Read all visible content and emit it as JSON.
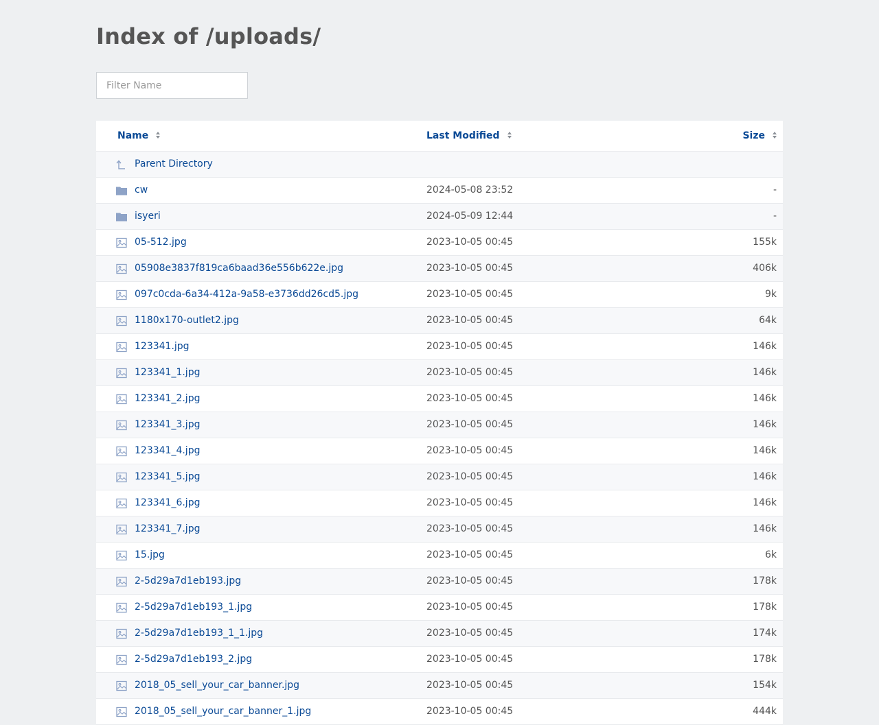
{
  "title": "Index of /uploads/",
  "filter": {
    "placeholder": "Filter Name",
    "value": ""
  },
  "columns": {
    "name": "Name",
    "modified": "Last Modified",
    "size": "Size"
  },
  "colors": {
    "link": "#0b4a96",
    "folder": "#8ea3c7",
    "background": "#eef0f2"
  },
  "parent": {
    "label": "Parent Directory",
    "icon": "arrow-up-icon"
  },
  "rows": [
    {
      "name": "cw",
      "modified": "2024-05-08 23:52",
      "size": "-",
      "type": "folder"
    },
    {
      "name": "isyeri",
      "modified": "2024-05-09 12:44",
      "size": "-",
      "type": "folder"
    },
    {
      "name": "05-512.jpg",
      "modified": "2023-10-05 00:45",
      "size": "155k",
      "type": "image"
    },
    {
      "name": "05908e3837f819ca6baad36e556b622e.jpg",
      "modified": "2023-10-05 00:45",
      "size": "406k",
      "type": "image"
    },
    {
      "name": "097c0cda-6a34-412a-9a58-e3736dd26cd5.jpg",
      "modified": "2023-10-05 00:45",
      "size": "9k",
      "type": "image"
    },
    {
      "name": "1180x170-outlet2.jpg",
      "modified": "2023-10-05 00:45",
      "size": "64k",
      "type": "image"
    },
    {
      "name": "123341.jpg",
      "modified": "2023-10-05 00:45",
      "size": "146k",
      "type": "image"
    },
    {
      "name": "123341_1.jpg",
      "modified": "2023-10-05 00:45",
      "size": "146k",
      "type": "image"
    },
    {
      "name": "123341_2.jpg",
      "modified": "2023-10-05 00:45",
      "size": "146k",
      "type": "image"
    },
    {
      "name": "123341_3.jpg",
      "modified": "2023-10-05 00:45",
      "size": "146k",
      "type": "image"
    },
    {
      "name": "123341_4.jpg",
      "modified": "2023-10-05 00:45",
      "size": "146k",
      "type": "image"
    },
    {
      "name": "123341_5.jpg",
      "modified": "2023-10-05 00:45",
      "size": "146k",
      "type": "image"
    },
    {
      "name": "123341_6.jpg",
      "modified": "2023-10-05 00:45",
      "size": "146k",
      "type": "image"
    },
    {
      "name": "123341_7.jpg",
      "modified": "2023-10-05 00:45",
      "size": "146k",
      "type": "image"
    },
    {
      "name": "15.jpg",
      "modified": "2023-10-05 00:45",
      "size": "6k",
      "type": "image"
    },
    {
      "name": "2-5d29a7d1eb193.jpg",
      "modified": "2023-10-05 00:45",
      "size": "178k",
      "type": "image"
    },
    {
      "name": "2-5d29a7d1eb193_1.jpg",
      "modified": "2023-10-05 00:45",
      "size": "178k",
      "type": "image"
    },
    {
      "name": "2-5d29a7d1eb193_1_1.jpg",
      "modified": "2023-10-05 00:45",
      "size": "174k",
      "type": "image"
    },
    {
      "name": "2-5d29a7d1eb193_2.jpg",
      "modified": "2023-10-05 00:45",
      "size": "178k",
      "type": "image"
    },
    {
      "name": "2018_05_sell_your_car_banner.jpg",
      "modified": "2023-10-05 00:45",
      "size": "154k",
      "type": "image"
    },
    {
      "name": "2018_05_sell_your_car_banner_1.jpg",
      "modified": "2023-10-05 00:45",
      "size": "444k",
      "type": "image"
    }
  ]
}
